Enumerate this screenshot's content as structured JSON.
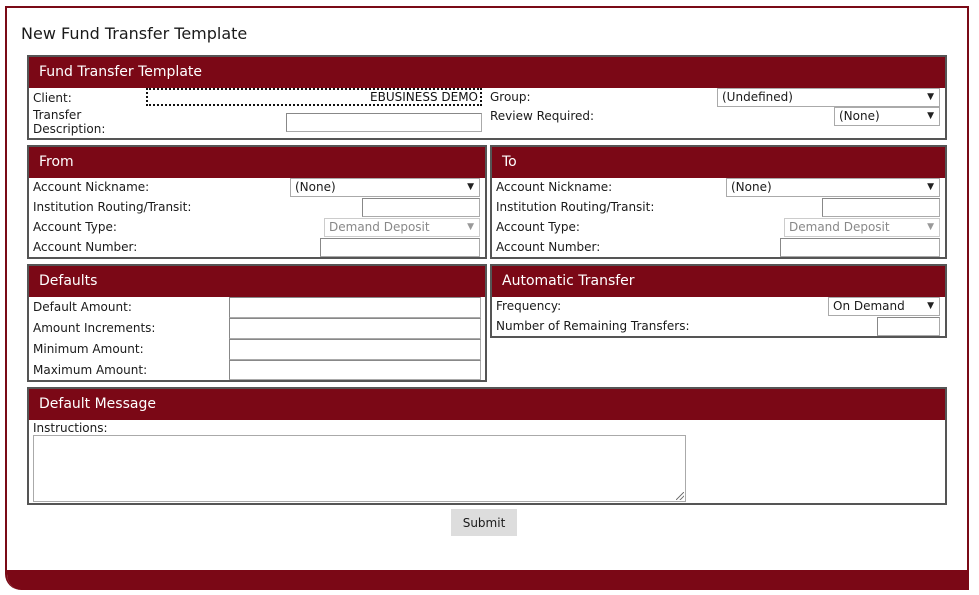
{
  "page": {
    "title": "New Fund Transfer Template",
    "colors": {
      "brand": "#7b0816",
      "panel_border": "#555555"
    }
  },
  "template_panel": {
    "heading": "Fund Transfer Template",
    "client_label": "Client:",
    "client_value": "EBUSINESS DEMO",
    "description_label_1": "Transfer",
    "description_label_2": "Description:",
    "description_value": "",
    "group_label": "Group:",
    "group_value": "(Undefined)",
    "review_label": "Review Required:",
    "review_value": "(None)"
  },
  "from_panel": {
    "heading": "From",
    "nickname_label": "Account Nickname:",
    "nickname_value": "(None)",
    "routing_label": "Institution Routing/Transit:",
    "routing_value": "",
    "type_label": "Account Type:",
    "type_value": "Demand Deposit",
    "number_label": "Account Number:",
    "number_value": ""
  },
  "to_panel": {
    "heading": "To",
    "nickname_label": "Account Nickname:",
    "nickname_value": "(None)",
    "routing_label": "Institution Routing/Transit:",
    "routing_value": "",
    "type_label": "Account Type:",
    "type_value": "Demand Deposit",
    "number_label": "Account Number:",
    "number_value": ""
  },
  "defaults_panel": {
    "heading": "Defaults",
    "default_amount_label": "Default Amount:",
    "increments_label": "Amount Increments:",
    "minimum_label": "Minimum Amount:",
    "maximum_label": "Maximum Amount:"
  },
  "auto_panel": {
    "heading": "Automatic Transfer",
    "frequency_label": "Frequency:",
    "frequency_value": "On Demand",
    "remaining_label": "Number of Remaining Transfers:",
    "remaining_value": ""
  },
  "message_panel": {
    "heading": "Default Message",
    "instructions_label": "Instructions:",
    "instructions_value": ""
  },
  "actions": {
    "submit_label": "Submit"
  },
  "icons": {
    "dropdown": "chevron-down-icon"
  }
}
